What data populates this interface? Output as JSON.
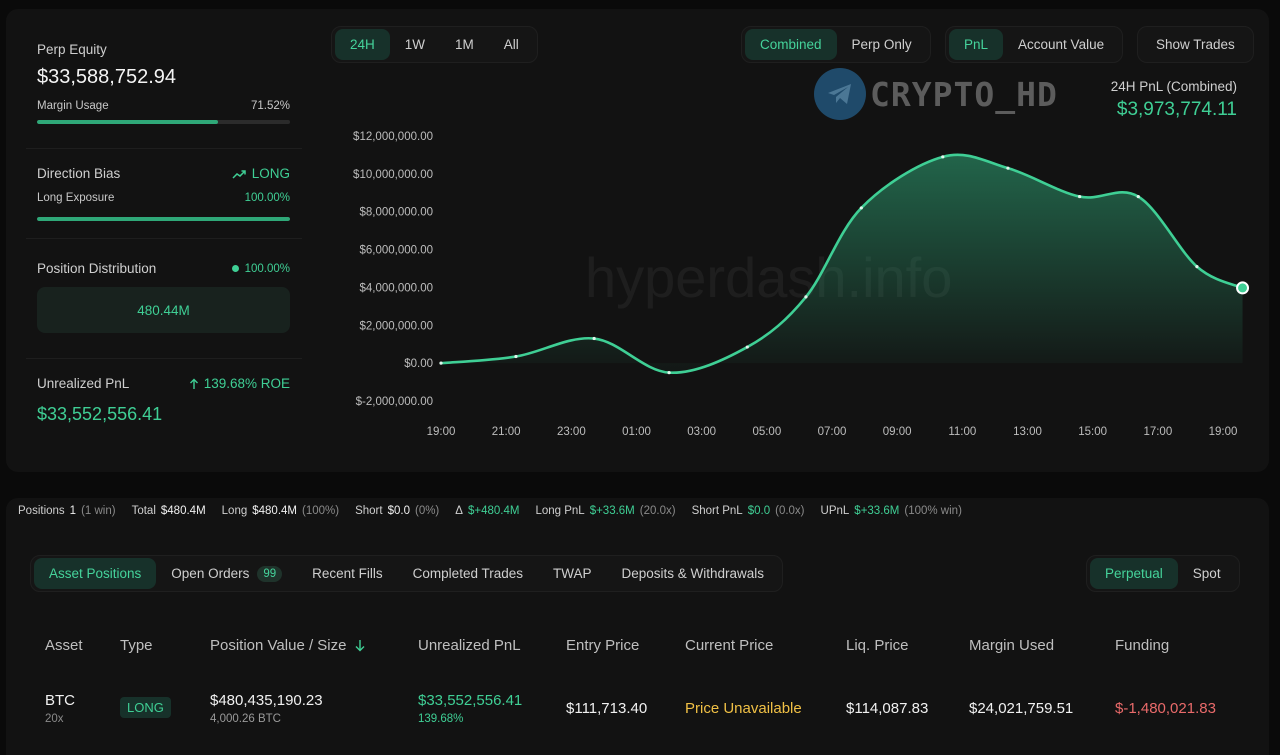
{
  "left_panel": {
    "equity_label": "Perp Equity",
    "equity_value": "$33,588,752.94",
    "margin_label": "Margin Usage",
    "margin_value": "71.52%",
    "margin_fraction": 0.7152,
    "bias_label": "Direction Bias",
    "bias_value": "LONG",
    "long_exposure_label": "Long Exposure",
    "long_exposure_value": "100.00%",
    "long_exposure_fraction": 1.0,
    "dist_label": "Position Distribution",
    "dist_value": "100.00%",
    "dist_box": "480.44M",
    "upnl_label": "Unrealized PnL",
    "upnl_roe": "139.68% ROE",
    "upnl_value": "$33,552,556.41"
  },
  "range_tabs": [
    {
      "label": "24H",
      "active": true
    },
    {
      "label": "1W",
      "active": false
    },
    {
      "label": "1M",
      "active": false
    },
    {
      "label": "All",
      "active": false
    }
  ],
  "mode_tabs": [
    {
      "label": "Combined",
      "active": true
    },
    {
      "label": "Perp Only",
      "active": false
    }
  ],
  "metric_tabs": [
    {
      "label": "PnL",
      "active": true
    },
    {
      "label": "Account Value",
      "active": false
    }
  ],
  "show_trades_label": "Show Trades",
  "logo_text": "CRYPTO_HD",
  "watermark_text": "hyperdash.info",
  "pnl_header": {
    "label": "24H PnL (Combined)",
    "value": "$3,973,774.11"
  },
  "colors": {
    "accent": "#3fcf95",
    "negative": "#e96a6a",
    "warning": "#f0c045"
  },
  "chart_data": {
    "type": "area",
    "x_labels": [
      "19:00",
      "21:00",
      "23:00",
      "01:00",
      "03:00",
      "05:00",
      "07:00",
      "09:00",
      "11:00",
      "13:00",
      "15:00",
      "17:00",
      "19:00"
    ],
    "y_tick_labels": [
      "$12,000,000.00",
      "$10,000,000.00",
      "$8,000,000.00",
      "$6,000,000.00",
      "$4,000,000.00",
      "$2,000,000.00",
      "$0.00",
      "$-2,000,000.00"
    ],
    "ylim": [
      -2000000,
      12000000
    ],
    "points": [
      {
        "h": 0,
        "y": 0
      },
      {
        "h": 2.3,
        "y": 350000
      },
      {
        "h": 4.7,
        "y": 1300000
      },
      {
        "h": 7.0,
        "y": -500000
      },
      {
        "h": 9.4,
        "y": 850000
      },
      {
        "h": 11.2,
        "y": 3500000
      },
      {
        "h": 12.9,
        "y": 8200000
      },
      {
        "h": 15.4,
        "y": 10900000
      },
      {
        "h": 17.4,
        "y": 10300000
      },
      {
        "h": 19.6,
        "y": 8800000
      },
      {
        "h": 21.4,
        "y": 8800000
      },
      {
        "h": 23.2,
        "y": 5100000
      },
      {
        "h": 24.6,
        "y": 3973774
      }
    ],
    "grid": false
  },
  "summary": {
    "positions_label": "Positions",
    "positions_value": "1",
    "positions_note": "(1 win)",
    "total_label": "Total",
    "total_value": "$480.4M",
    "long_label": "Long",
    "long_value": "$480.4M",
    "long_note": "(100%)",
    "short_label": "Short",
    "short_value": "$0.0",
    "short_note": "(0%)",
    "delta_label": "Δ",
    "delta_value": "$+480.4M",
    "longpnl_label": "Long PnL",
    "longpnl_value": "$+33.6M",
    "longpnl_note": "(20.0x)",
    "shortpnl_label": "Short PnL",
    "shortpnl_value": "$0.0",
    "shortpnl_note": "(0.0x)",
    "upnl_label": "UPnL",
    "upnl_value": "$+33.6M",
    "upnl_note": "(100% win)"
  },
  "bottom_tabs": [
    {
      "label": "Asset Positions",
      "active": true
    },
    {
      "label": "Open Orders",
      "active": false,
      "count": "99"
    },
    {
      "label": "Recent Fills",
      "active": false
    },
    {
      "label": "Completed Trades",
      "active": false
    },
    {
      "label": "TWAP",
      "active": false
    },
    {
      "label": "Deposits & Withdrawals",
      "active": false
    }
  ],
  "market_tabs": [
    {
      "label": "Perpetual",
      "active": true
    },
    {
      "label": "Spot",
      "active": false
    }
  ],
  "table": {
    "headers": [
      "Asset",
      "Type",
      "Position Value / Size",
      "Unrealized PnL",
      "Entry Price",
      "Current Price",
      "Liq. Price",
      "Margin Used",
      "Funding"
    ],
    "row": {
      "asset": "BTC",
      "leverage": "20x",
      "type": "LONG",
      "value": "$480,435,190.23",
      "size": "4,000.26 BTC",
      "upnl": "$33,552,556.41",
      "upnl_pct": "139.68%",
      "entry": "$111,713.40",
      "current": "Price Unavailable",
      "liq": "$114,087.83",
      "margin": "$24,021,759.51",
      "funding": "$-1,480,021.83"
    }
  }
}
